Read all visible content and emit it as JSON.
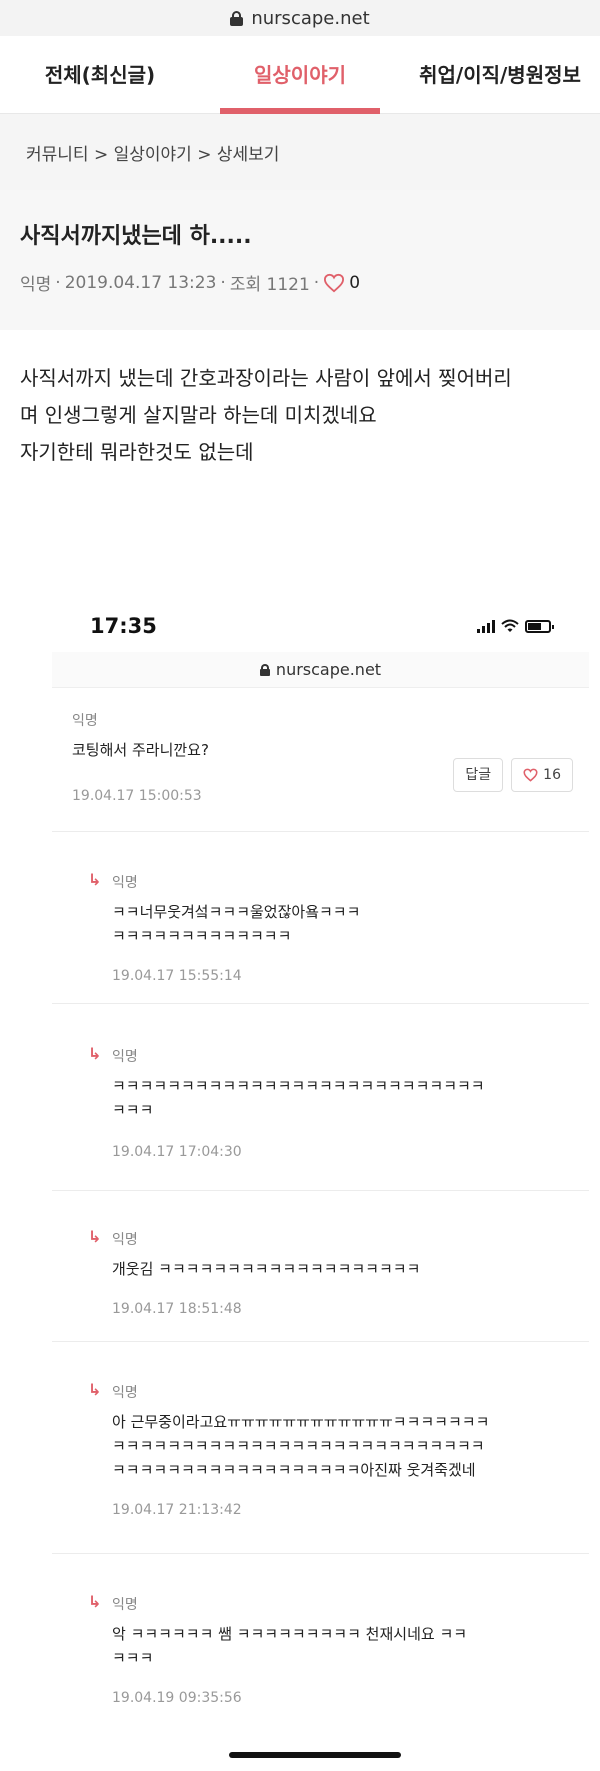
{
  "browser": {
    "url": "nurscape.net"
  },
  "tabs": [
    {
      "label": "전체(최신글)",
      "active": false
    },
    {
      "label": "일상이야기",
      "active": true
    },
    {
      "label": "취업/이직/병원정보",
      "active": false
    }
  ],
  "breadcrumb": "커뮤니티 > 일상이야기 > 상세보기",
  "post": {
    "title": "사직서까지냈는데 하.....",
    "author": "익명",
    "date": "2019.04.17 13:23",
    "views_label": "조회 1121",
    "likes": "0",
    "body_lines": [
      "사직서까지 냈는데 간호과장이라는 사람이 앞에서 찢어버리",
      "며 인생그렇게 살지말라 하는데 미치겠네요",
      "자기한테 뭐라한것도 없는데"
    ]
  },
  "embedded_screenshot": {
    "status_time": "17:35",
    "url": "nurscape.net",
    "comment": {
      "author": "익명",
      "text": "코팅해서 주라니깐요?",
      "date": "19.04.17 15:00:53",
      "reply_button": "답글",
      "likes": "16"
    },
    "replies": [
      {
        "author": "익명",
        "lines": [
          "ㅋㅋ너무웃겨섴ㅋㅋㅋ울었잖아욬ㅋㅋㅋ",
          "ㅋㅋㅋㅋㅋㅋㅋㅋㅋㅋㅋㅋㅋ"
        ],
        "date": "19.04.17 15:55:14"
      },
      {
        "author": "익명",
        "lines": [
          "ㅋㅋㅋㅋㅋㅋㅋㅋㅋㅋㅋㅋㅋㅋㅋㅋㅋㅋㅋㅋㅋㅋㅋㅋㅋㅋㅋ",
          "ㅋㅋㅋ"
        ],
        "date": "19.04.17 17:04:30"
      },
      {
        "author": "익명",
        "lines": [
          "개웃김 ㅋㅋㅋㅋㅋㅋㅋㅋㅋㅋㅋㅋㅋㅋㅋㅋㅋㅋㅋ"
        ],
        "date": "19.04.17 18:51:48"
      },
      {
        "author": "익명",
        "lines": [
          "아 근무중이라고요ㅠㅠㅠㅠㅠㅠㅠㅠㅠㅠㅠㅠㅋㅋㅋㅋㅋㅋㅋ",
          "ㅋㅋㅋㅋㅋㅋㅋㅋㅋㅋㅋㅋㅋㅋㅋㅋㅋㅋㅋㅋㅋㅋㅋㅋㅋㅋㅋ",
          "ㅋㅋㅋㅋㅋㅋㅋㅋㅋㅋㅋㅋㅋㅋㅋㅋㅋㅋ아진짜 웃겨죽겠네"
        ],
        "date": "19.04.17 21:13:42"
      },
      {
        "author": "익명",
        "lines": [
          "악 ㅋㅋㅋㅋㅋㅋ 쌤 ㅋㅋㅋㅋㅋㅋㅋㅋㅋ 천재시네요 ㅋㅋ",
          "ㅋㅋㅋ"
        ],
        "date": "19.04.19 09:35:56"
      }
    ]
  },
  "colors": {
    "accent": "#e0606a",
    "meta": "#777777"
  }
}
